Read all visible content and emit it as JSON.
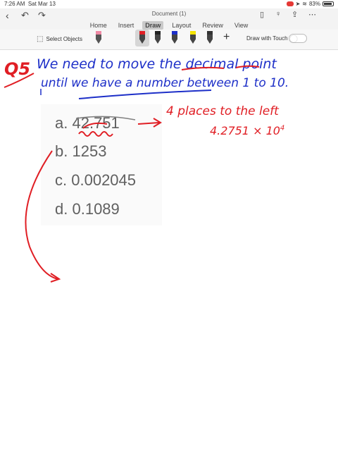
{
  "status": {
    "time": "7:26 AM",
    "date": "Sat Mar 13",
    "battery": "83%"
  },
  "app": {
    "doc_title": "Document (1)"
  },
  "tabs": [
    {
      "label": "Home"
    },
    {
      "label": "Insert"
    },
    {
      "label": "Draw",
      "active": true
    },
    {
      "label": "Layout"
    },
    {
      "label": "Review"
    },
    {
      "label": "View"
    }
  ],
  "ribbon": {
    "select_objects": "Select Objects",
    "draw_with_touch": "Draw with Touch"
  },
  "question": {
    "options": [
      {
        "letter": "a.",
        "value": "42.751"
      },
      {
        "letter": "b.",
        "value": "1253"
      },
      {
        "letter": "c.",
        "value": "0.002045"
      },
      {
        "letter": "d.",
        "value": "0.1089"
      }
    ]
  },
  "handwriting": {
    "label": "Q5",
    "line1": "We need to move the decimal point",
    "line2": "until we have a number between 1 to 10.",
    "note": "4 places to the left",
    "result": "4.2751 × 10"
  },
  "colors": {
    "blue_ink": "#1d2fc8",
    "red_ink": "#e01e24"
  },
  "icons": [
    "back-chevron-icon",
    "undo-icon",
    "redo-icon",
    "phone-icon",
    "lightbulb-icon",
    "share-icon",
    "more-icon",
    "eraser-icon",
    "pen-icon",
    "highlighter-icon",
    "plus-icon"
  ]
}
